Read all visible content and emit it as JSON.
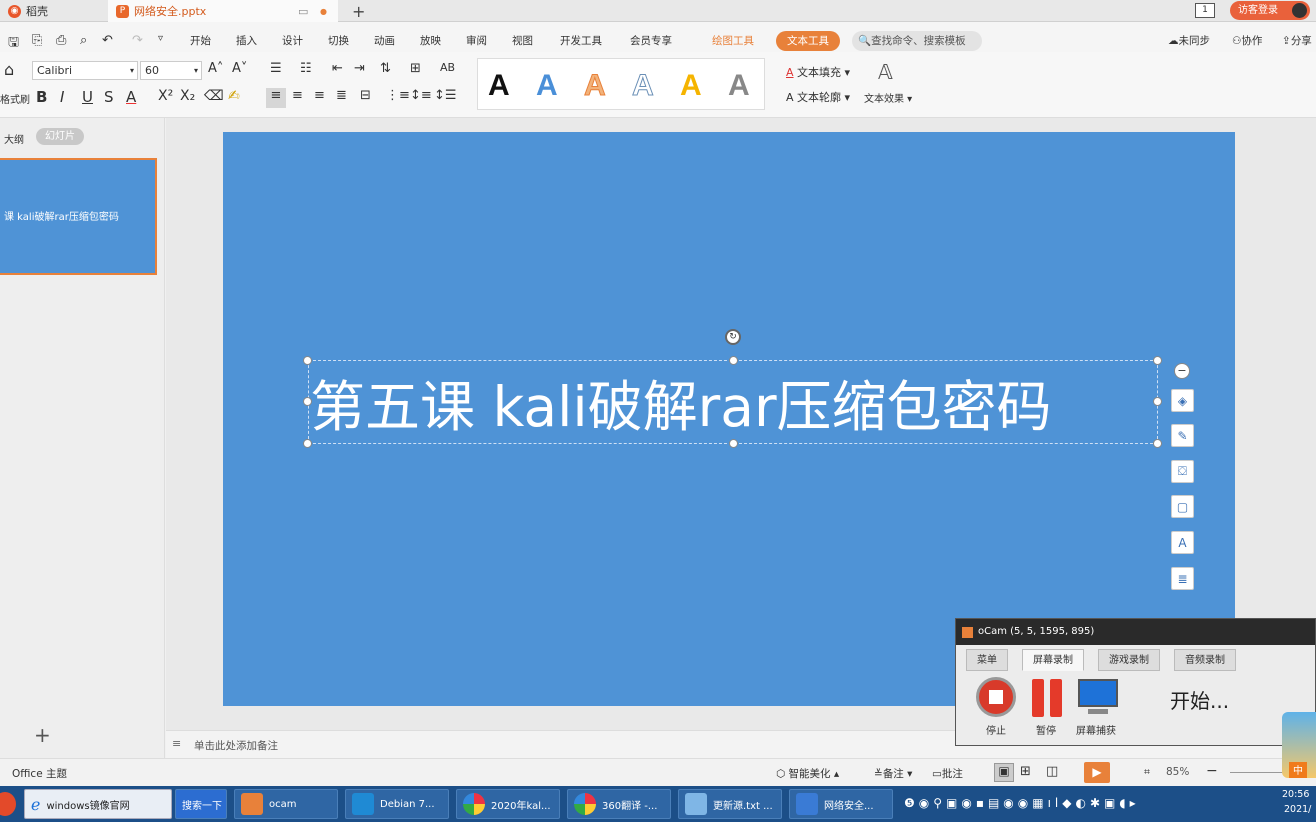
{
  "tabs": {
    "home": "稻壳",
    "file": "网络安全.pptx",
    "add": "+"
  },
  "titlebar": {
    "badge": "1",
    "login": "访客登录"
  },
  "menu": {
    "items": [
      "开始",
      "插入",
      "设计",
      "切换",
      "动画",
      "放映",
      "审阅",
      "视图",
      "开发工具",
      "会员专享"
    ],
    "drawing_tools": "绘图工具",
    "text_tools": "文本工具",
    "search": "查找命令、搜索模板",
    "sync": "未同步",
    "collab": "协作",
    "share": "分享"
  },
  "ribbon": {
    "font": "Calibri",
    "size": "60",
    "format_painter": "格式刷",
    "fill": "文本填充",
    "outline": "文本轮廓",
    "effects": "文本效果",
    "wordart": [
      "A",
      "A",
      "A",
      "A",
      "A",
      "A"
    ]
  },
  "leftpane": {
    "outline_tab": "大纲",
    "slides_tab": "幻灯片",
    "thumb_text": "课  kali破解rar压缩包密码",
    "add": "+"
  },
  "slide": {
    "title": "第五课   kali破解rar压缩包密码",
    "bg": "#4f93d6"
  },
  "notes": {
    "placeholder": "单击此处添加备注"
  },
  "status": {
    "theme": "Office 主题",
    "beautify": "智能美化",
    "notes": "备注",
    "comments": "批注",
    "zoom": "85%"
  },
  "ocam": {
    "title": "oCam (5, 5, 1595, 895)",
    "tabs": [
      "菜单",
      "屏幕录制",
      "游戏录制",
      "音频录制"
    ],
    "stop": "停止",
    "pause": "暂停",
    "capture": "屏幕捕获",
    "status": "开始..."
  },
  "taskbar": {
    "items": [
      "windows镜像官网",
      "搜索一下",
      "ocam",
      "Debian 7...",
      "2020年kal...",
      "360翻译 -...",
      "更新源.txt ...",
      "网络安全..."
    ],
    "time": "20:56",
    "date": "2021/"
  }
}
